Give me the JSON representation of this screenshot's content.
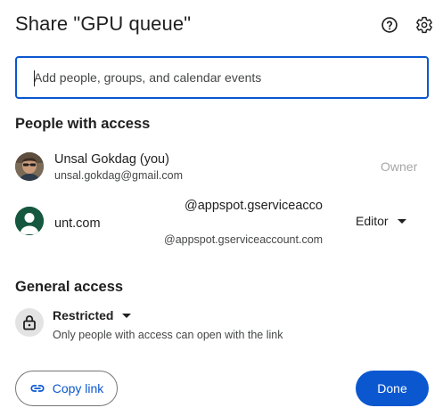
{
  "dialog": {
    "title": "Share \"GPU queue\"",
    "help_icon": "help-circle-icon",
    "settings_icon": "gear-icon"
  },
  "add_people": {
    "placeholder": "Add people, groups, and calendar events"
  },
  "people_section": {
    "heading": "People with access",
    "people": [
      {
        "name": "Unsal Gokdag (you)",
        "email": "unsal.gokdag@gmail.com",
        "role": "Owner",
        "avatar": "profile-photo"
      },
      {
        "name_part1": "@appspot.gserviceacco",
        "name_part2": "unt.com",
        "email": "@appspot.gserviceaccount.com",
        "role": "Editor",
        "avatar": "person-icon"
      }
    ]
  },
  "general_access": {
    "heading": "General access",
    "level": "Restricted",
    "description": "Only people with access can open with the link",
    "icon": "lock-icon"
  },
  "footer": {
    "copy_link_label": "Copy link",
    "copy_link_icon": "link-icon",
    "done_label": "Done"
  },
  "colors": {
    "accent": "#0b57d0",
    "text": "#1f1f1f",
    "muted": "#444746",
    "disabled": "#a4a7a6",
    "service_avatar": "#16573f"
  }
}
